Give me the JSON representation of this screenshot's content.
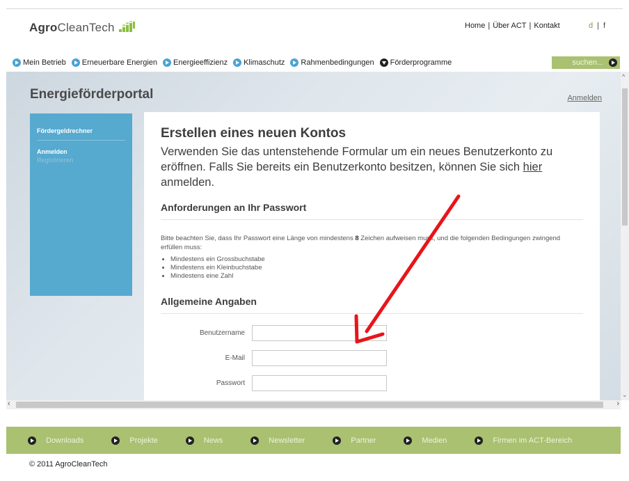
{
  "header": {
    "logo_bold": "Agro",
    "logo_light": "CleanTech",
    "top_links": [
      "Home",
      "Über ACT",
      "Kontakt"
    ],
    "link_separator": "|",
    "lang_de": "d",
    "lang_fr": "f"
  },
  "nav": {
    "items": [
      {
        "label": "Mein Betrieb",
        "icon": "play-circle-icon"
      },
      {
        "label": "Erneuerbare Energien",
        "icon": "play-circle-icon"
      },
      {
        "label": "Energieeffizienz",
        "icon": "play-circle-icon"
      },
      {
        "label": "Klimaschutz",
        "icon": "play-circle-icon"
      },
      {
        "label": "Rahmenbedingungen",
        "icon": "play-circle-icon"
      },
      {
        "label": "Förderprogramme",
        "icon": "chevron-down-circle-icon"
      }
    ],
    "search_placeholder": "suchen..."
  },
  "portal": {
    "title": "Energieförderportal",
    "login_link": "Anmelden",
    "sidebar": {
      "items": [
        "Fördergeldrechner",
        "Anmelden",
        "Registrieren"
      ]
    },
    "content": {
      "heading": "Erstellen eines neuen Kontos",
      "intro_before": "Verwenden Sie das untenstehende Formular um ein neues Benutzerkonto zu eröffnen. Falls Sie bereits ein Benutzerkonto besitzen, können Sie sich ",
      "intro_link": "hier",
      "intro_after": " anmelden.",
      "password_heading": "Anforderungen an Ihr Passwort",
      "password_text_before": "Bitte beachten Sie, dass Ihr Passwort eine Länge von mindestens ",
      "password_min": "8",
      "password_text_after": " Zeichen aufweisen muss, und die folgenden Bedingungen zwingend erfüllen muss:",
      "requirements": [
        "Mindestens ein Grossbuchstabe",
        "Mindestens ein Kleinbuchstabe",
        "Mindestens eine Zahl"
      ],
      "general_heading": "Allgemeine Angaben",
      "fields": [
        {
          "label": "Benutzername",
          "value": ""
        },
        {
          "label": "E-Mail",
          "value": ""
        },
        {
          "label": "Passwort",
          "value": ""
        }
      ]
    }
  },
  "footer": {
    "links": [
      "Downloads",
      "Projekte",
      "News",
      "Newsletter",
      "Partner",
      "Medien",
      "Firmen im ACT-Bereich"
    ],
    "copyright": "© 2011 AgroCleanTech"
  },
  "colors": {
    "green": "#a9c170",
    "blue": "#56a9cf",
    "arrow_red": "#e8141a"
  }
}
